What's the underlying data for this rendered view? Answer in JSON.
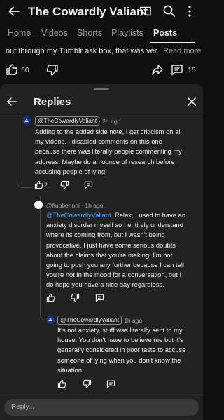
{
  "header": {
    "title": "The Cowardly Valiant",
    "icons": [
      "back-arrow-icon",
      "cast-icon",
      "search-icon",
      "more-vertical-icon"
    ]
  },
  "tabs": [
    {
      "label": "Home",
      "active": false
    },
    {
      "label": "Videos",
      "active": false
    },
    {
      "label": "Shorts",
      "active": false
    },
    {
      "label": "Playlists",
      "active": false
    },
    {
      "label": "Posts",
      "active": true
    }
  ],
  "post": {
    "text_snippet": "out through my Tumblr ask box, that was ver...",
    "read_more": "Read more",
    "like_count": "50",
    "comment_count": "15"
  },
  "replies_sheet": {
    "title": "Replies",
    "comments": [
      {
        "mention": "@TheCowardlyValiant",
        "time": "· 2h ago",
        "lines": [
          "Adding to the added side note, I get criticism on all",
          "my videos. I disabled comments on this one",
          "because there was literally people commenting my",
          "address. Maybe do an ounce of research before",
          "accusing people of lying"
        ],
        "like_count": "2"
      },
      {
        "author": "@flubberinni",
        "time": "· 1h ago",
        "mention": "@TheCowardlyValiant",
        "first_line_rest": "Relax, I used to have an",
        "lines": [
          "anxiety disorder myself so I entirely understand",
          "where its coming from, but I wasn't being",
          "provocative. I just have some serious doubts",
          "about the claims that you're making. I'm not",
          "going to push you any further because I can tell",
          "you're not in the mood for a conversation, but I",
          "do hope you have a nice day regardless."
        ]
      },
      {
        "mention": "@TheCowardlyValiant",
        "time": "· 1h ago",
        "lines": [
          "It's not anxiety, stuff was literally sent to my",
          "house. You don't have to believe me but it's",
          "generally considered in poor taste to accuse",
          "someone of lying when you don't know the",
          "situation."
        ]
      }
    ]
  },
  "reply_input": {
    "placeholder": "Reply..."
  },
  "colors": {
    "background": "#0f0f0f",
    "sheet": "#212121",
    "link": "#3ea6ff",
    "muted_text": "#aaaaaa"
  }
}
